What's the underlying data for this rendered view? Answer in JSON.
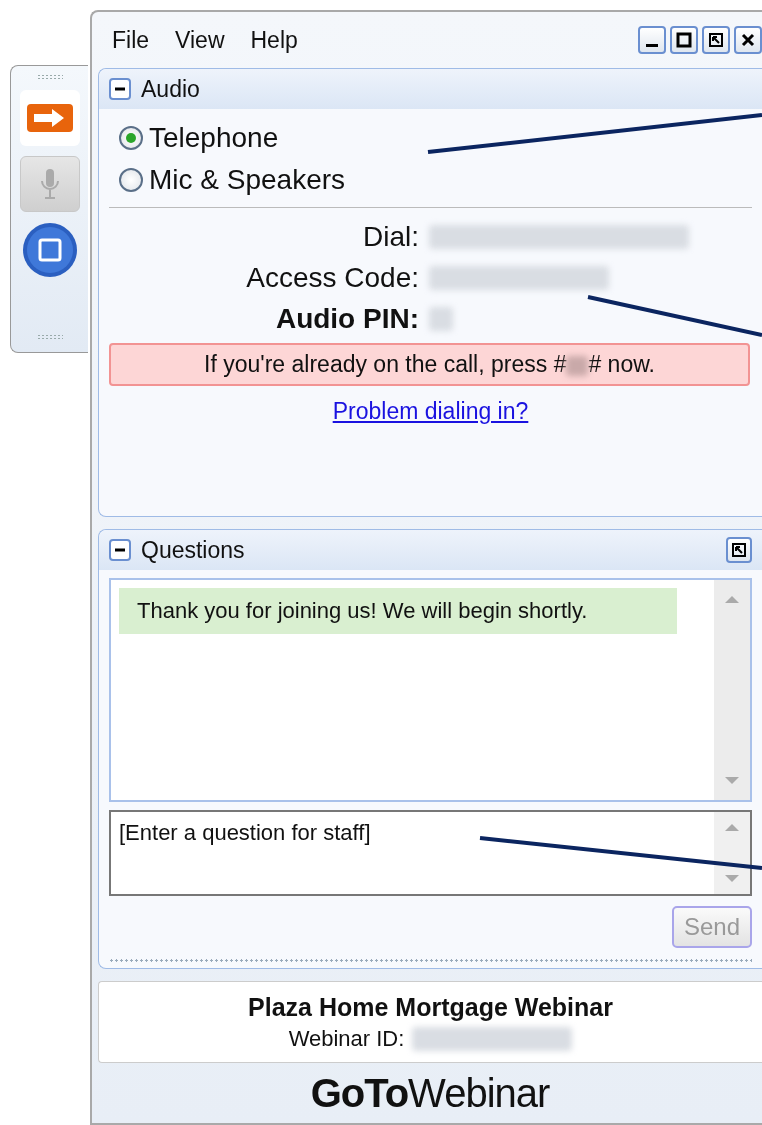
{
  "toolbar": {
    "buttons": [
      {
        "kind": "arrow",
        "disabled": false
      },
      {
        "kind": "mic",
        "disabled": true
      },
      {
        "kind": "screen",
        "disabled": false
      }
    ]
  },
  "menu": [
    "File",
    "View",
    "Help"
  ],
  "window_controls": [
    {
      "kind": "minimize"
    },
    {
      "kind": "maximize"
    },
    {
      "kind": "restore"
    },
    {
      "kind": "close"
    }
  ],
  "audio": {
    "title": "Audio",
    "expanded": true,
    "options": [
      {
        "label": "Telephone",
        "selected": true
      },
      {
        "label": "Mic & Speakers",
        "selected": false
      }
    ],
    "details": [
      {
        "label": "Dial:",
        "bold": false
      },
      {
        "label": "Access Code:",
        "bold": false
      },
      {
        "label": "Audio PIN:",
        "bold": true
      }
    ],
    "notice": {
      "before": "If you're already on the call, press #",
      "after": "# now."
    },
    "link": "Problem dialing in?"
  },
  "questions": {
    "title": "Questions",
    "expanded": true,
    "messages": [
      "Thank you for joining us! We will begin shortly."
    ],
    "input": {
      "placeholder": "[Enter a question for staff]"
    },
    "send": {
      "label": "Send",
      "disabled": true
    }
  },
  "webinar": {
    "title": "Plaza Home Mortgage Webinar",
    "id_label": "Webinar ID:"
  },
  "logo": "**GoTo**Webinar"
}
